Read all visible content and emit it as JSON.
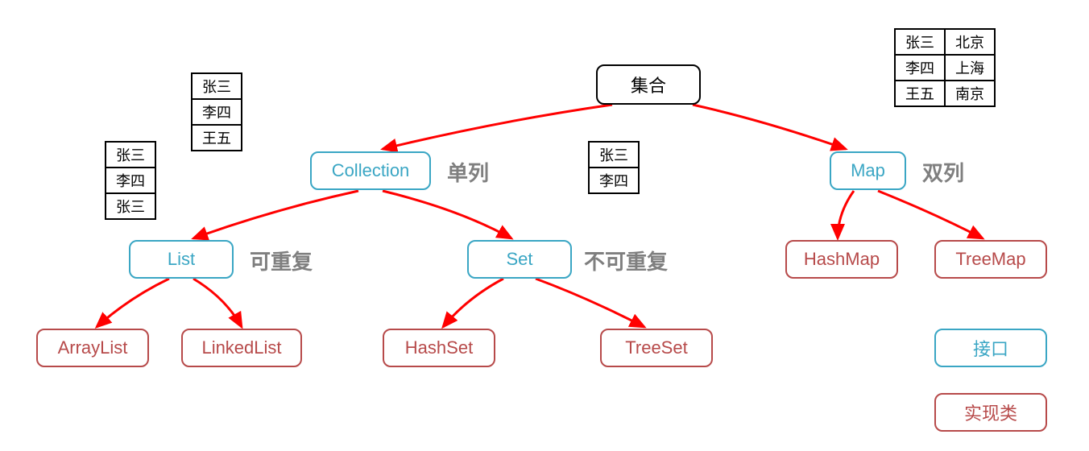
{
  "root": {
    "label": "集合"
  },
  "collection": {
    "label": "Collection",
    "annotation": "单列"
  },
  "map": {
    "label": "Map",
    "annotation": "双列"
  },
  "list": {
    "label": "List",
    "annotation": "可重复"
  },
  "set": {
    "label": "Set",
    "annotation": "不可重复"
  },
  "arraylist": {
    "label": "ArrayList"
  },
  "linkedlist": {
    "label": "LinkedList"
  },
  "hashset": {
    "label": "HashSet"
  },
  "treeset": {
    "label": "TreeSet"
  },
  "hashmap": {
    "label": "HashMap"
  },
  "treemap": {
    "label": "TreeMap"
  },
  "legend": {
    "interface": "接口",
    "class": "实现类"
  },
  "tables": {
    "list_dup": [
      "张三",
      "李四",
      "张三"
    ],
    "set_unique": [
      "张三",
      "李四",
      "王五"
    ],
    "set_small": [
      "张三",
      "李四"
    ],
    "map_kv": [
      [
        "张三",
        "北京"
      ],
      [
        "李四",
        "上海"
      ],
      [
        "王五",
        "南京"
      ]
    ]
  },
  "colors": {
    "arrow": "#ff0000",
    "interface": "#3aa6c4",
    "class": "#b74a4a",
    "label": "#7f7f7f"
  }
}
